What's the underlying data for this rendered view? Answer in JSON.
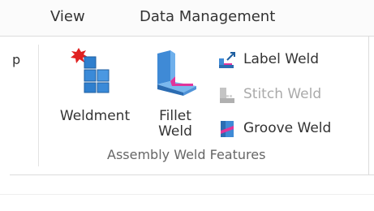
{
  "tabs": [
    {
      "label": "View"
    },
    {
      "label": "Data Management"
    }
  ],
  "prev_group_fragment": "p",
  "group": {
    "label": "Assembly Weld Features",
    "buttons": {
      "weldment": {
        "label": "Weldment",
        "icon": "weldment-icon"
      },
      "fillet_weld": {
        "label_line1": "Fillet",
        "label_line2": "Weld",
        "icon": "fillet-weld-icon"
      },
      "label_weld": {
        "label": "Label Weld",
        "icon": "label-weld-icon"
      },
      "stitch_weld": {
        "label": "Stitch Weld",
        "icon": "stitch-weld-icon",
        "enabled": false
      },
      "groove_weld": {
        "label": "Groove Weld",
        "icon": "groove-weld-icon"
      }
    }
  },
  "colors": {
    "accent_blue": "#2e7fd0",
    "weld_magenta": "#e0359b",
    "star_red": "#e02020",
    "disabled_text": "#aaaaaa"
  }
}
